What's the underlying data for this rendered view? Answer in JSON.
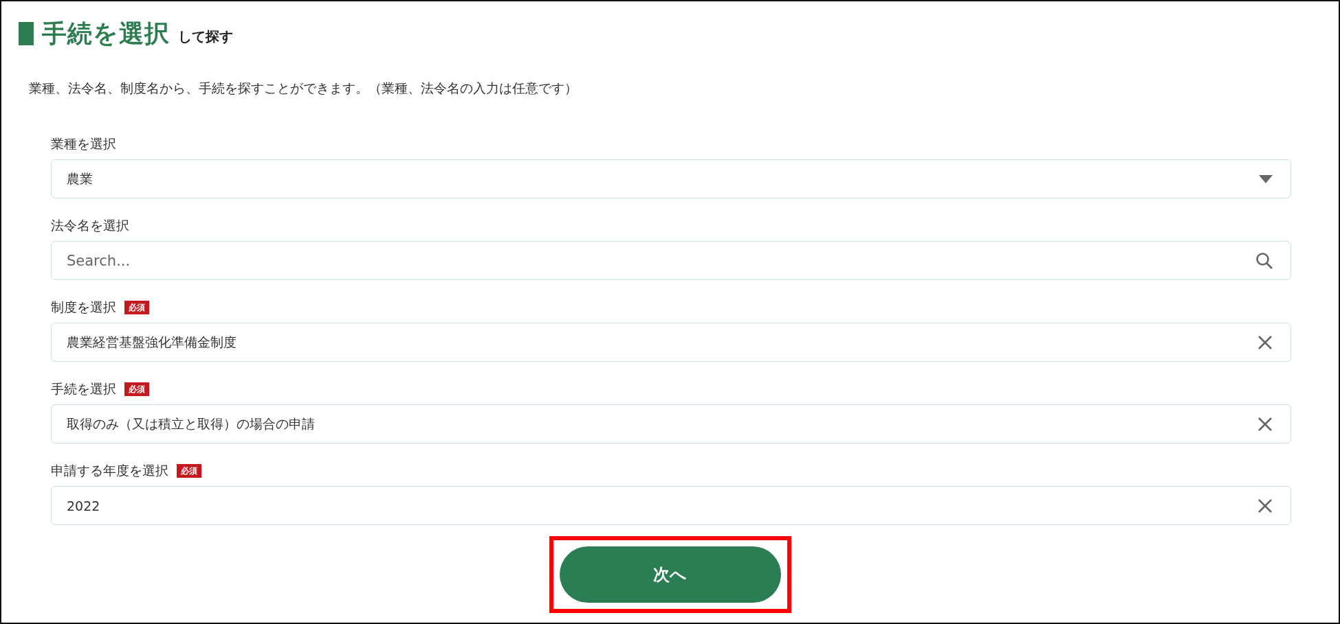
{
  "heading": {
    "title": "手続を選択",
    "suffix": "して探す"
  },
  "description": "業種、法令名、制度名から、手続を探すことができます。（業種、法令名の入力は任意です）",
  "fields": [
    {
      "label": "業種を選択",
      "required": false,
      "kind": "select",
      "value": "農業"
    },
    {
      "label": "法令名を選択",
      "required": false,
      "kind": "search",
      "placeholder": "Search..."
    },
    {
      "label": "制度を選択",
      "required": true,
      "required_label": "必須",
      "kind": "clearable",
      "value": "農業経営基盤強化準備金制度"
    },
    {
      "label": "手続を選択",
      "required": true,
      "required_label": "必須",
      "kind": "clearable",
      "value": "取得のみ（又は積立と取得）の場合の申請"
    },
    {
      "label": "申請する年度を選択",
      "required": true,
      "required_label": "必須",
      "kind": "clearable",
      "value": "2022"
    }
  ],
  "next_button": {
    "label": "次へ",
    "highlighted": true
  }
}
